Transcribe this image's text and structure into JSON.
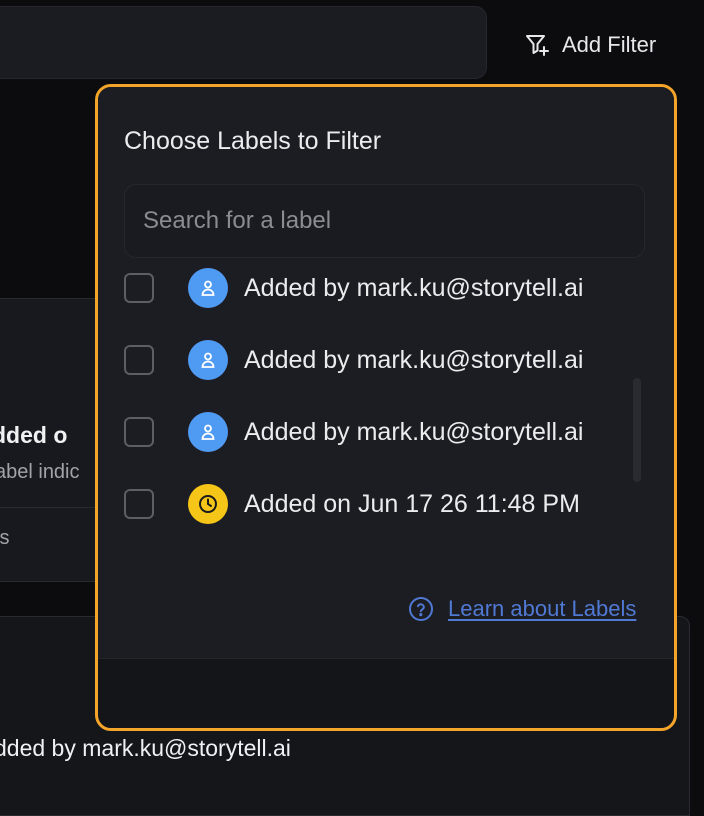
{
  "toolbar": {
    "add_filter_label": "Add Filter"
  },
  "background": {
    "card_title": "dded o",
    "card_subtitle": "abel indic",
    "card_meta": "ts",
    "bottom_label": "dded by mark.ku@storytell.ai"
  },
  "popover": {
    "title": "Choose Labels to Filter",
    "search_placeholder": "Search for a label",
    "search_value": "",
    "options": [
      {
        "label": "Added by mark.ku@storytell.ai",
        "icon": "user-icon",
        "color": "#4f9bf4",
        "checked": false
      },
      {
        "label": "Added by mark.ku@storytell.ai",
        "icon": "user-icon",
        "color": "#4f9bf4",
        "checked": false
      },
      {
        "label": "Added by mark.ku@storytell.ai",
        "icon": "user-icon",
        "color": "#4f9bf4",
        "checked": false
      },
      {
        "label": "Added on Jun 17 26 11:48 PM",
        "icon": "clock-icon",
        "color": "#f5c518",
        "checked": false
      }
    ],
    "learn_link": {
      "icon": "help-circle-icon",
      "label": "Learn about Labels"
    }
  },
  "colors": {
    "popover_border": "#f3a429",
    "link": "#4f79d3",
    "user_badge": "#4f9bf4",
    "clock_badge": "#f5c518"
  }
}
